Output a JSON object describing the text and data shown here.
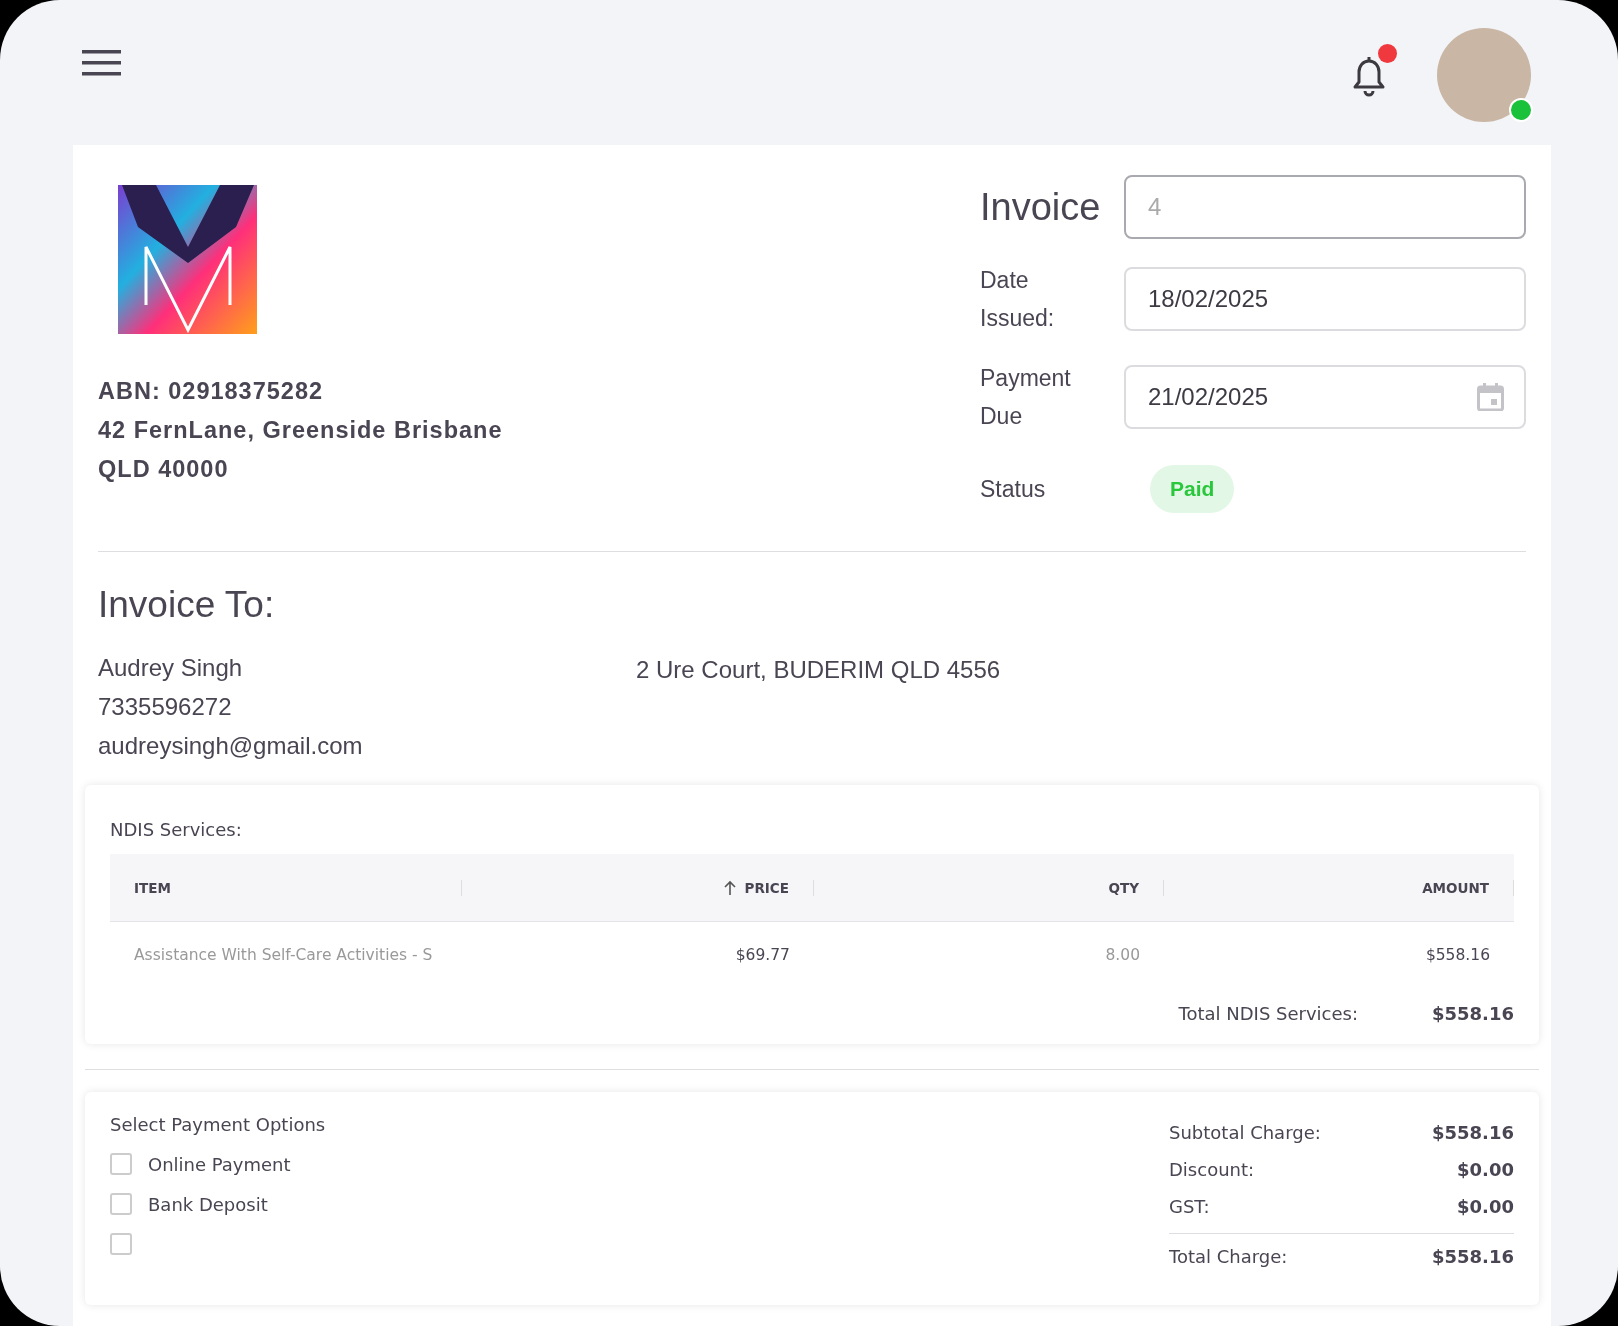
{
  "header": {
    "notifications": {
      "unread": true
    },
    "user": {
      "online": true
    }
  },
  "company": {
    "abn": "ABN: 02918375282",
    "address_lines": [
      "42 FernLane, Greenside Brisbane",
      "QLD 40000"
    ]
  },
  "invoice": {
    "title": "Invoice",
    "number": {
      "placeholder": "4"
    },
    "fields": [
      {
        "kind": "text",
        "label": "Date Issued:",
        "value": "18/02/2025"
      },
      {
        "kind": "date",
        "label": "Payment Due",
        "value": "21/02/2025"
      }
    ],
    "status": {
      "label": "Status",
      "value": "Paid",
      "kind": "paid"
    }
  },
  "bill_to": {
    "heading": "Invoice To:",
    "name": "Audrey Singh",
    "phone": "7335596272",
    "email": "audreysingh@gmail.com",
    "address": "2 Ure Court, BUDERIM QLD 4556"
  },
  "services": {
    "title": "NDIS Services:",
    "columns": [
      {
        "label": "ITEM",
        "sorted": false
      },
      {
        "label": "PRICE",
        "sorted": true
      },
      {
        "label": "QTY",
        "sorted": false
      },
      {
        "label": "AMOUNT",
        "sorted": false
      }
    ],
    "rows": [
      [
        "Assistance With Self-Care Activities - S",
        "$69.77",
        "8.00",
        "$558.16"
      ]
    ],
    "total_label": "Total NDIS Services:",
    "total_value": "$558.16"
  },
  "payment": {
    "title": "Select Payment Options",
    "options": [
      {
        "label": "Online Payment",
        "checked": false
      },
      {
        "label": "Bank Deposit",
        "checked": false
      },
      {
        "checked": false
      }
    ],
    "summary": [
      {
        "label": "Subtotal Charge:",
        "value": "$558.16"
      },
      {
        "label": "Discount:",
        "value": "$0.00"
      },
      {
        "label": "GST:",
        "value": "$0.00"
      }
    ],
    "total": {
      "label": "Total Charge:",
      "value": "$558.16"
    }
  }
}
